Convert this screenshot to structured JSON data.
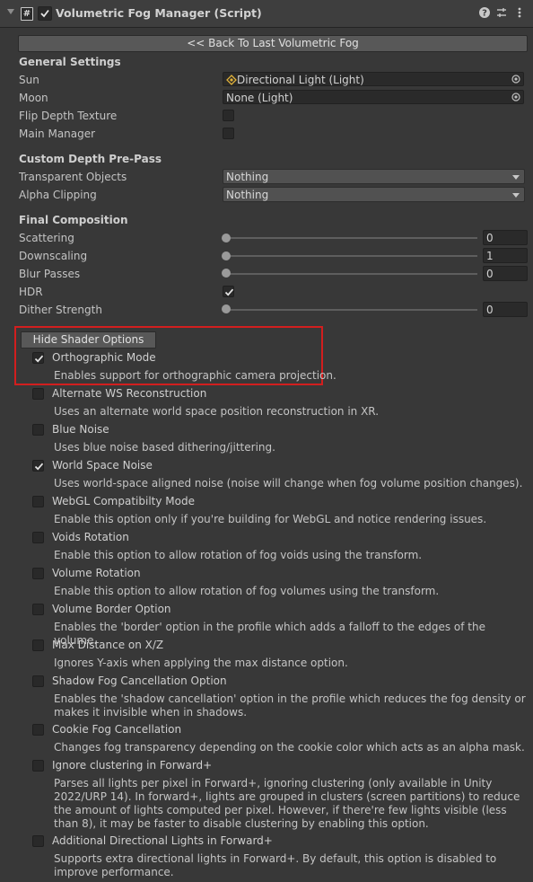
{
  "header": {
    "title": "Volumetric Fog Manager (Script)",
    "enabled": true
  },
  "back_button": "<< Back To Last Volumetric Fog",
  "general": {
    "title": "General Settings",
    "sun_label": "Sun",
    "sun_value": "Directional Light (Light)",
    "moon_label": "Moon",
    "moon_value": "None (Light)",
    "flip_label": "Flip Depth Texture",
    "flip_checked": false,
    "main_label": "Main Manager",
    "main_checked": false
  },
  "custom_depth": {
    "title": "Custom Depth Pre-Pass",
    "transparent_label": "Transparent Objects",
    "transparent_value": "Nothing",
    "alpha_label": "Alpha Clipping",
    "alpha_value": "Nothing"
  },
  "final": {
    "title": "Final Composition",
    "scattering_label": "Scattering",
    "scattering_value": "0",
    "downscaling_label": "Downscaling",
    "downscaling_value": "1",
    "blur_label": "Blur Passes",
    "blur_value": "0",
    "hdr_label": "HDR",
    "hdr_checked": true,
    "dither_label": "Dither Strength",
    "dither_value": "0"
  },
  "shader_options": {
    "toggle_label": "Hide Shader Options",
    "items": [
      {
        "title": "Orthographic Mode",
        "checked": true,
        "desc": "Enables support for orthographic camera projection."
      },
      {
        "title": "Alternate WS Reconstruction",
        "checked": false,
        "desc": "Uses an alternate world space position reconstruction in XR."
      },
      {
        "title": "Blue Noise",
        "checked": false,
        "desc": "Uses blue noise based dithering/jittering."
      },
      {
        "title": "World Space Noise",
        "checked": true,
        "desc": "Uses world-space aligned noise (noise will change when fog volume position changes)."
      },
      {
        "title": "WebGL Compatibilty Mode",
        "checked": false,
        "desc": "Enable this option only if you're building for WebGL and notice rendering issues."
      },
      {
        "title": "Voids Rotation",
        "checked": false,
        "desc": "Enable this option to allow rotation of fog voids using the transform."
      },
      {
        "title": "Volume Rotation",
        "checked": false,
        "desc": "Enable this option to allow rotation of fog volumes using the transform."
      },
      {
        "title": "Volume Border Option",
        "checked": false,
        "desc": "Enables the 'border' option in the profile which adds a falloff to the edges of the volume."
      },
      {
        "title": "Max Distance on X/Z",
        "checked": false,
        "desc": "Ignores Y-axis when applying the max distance option."
      },
      {
        "title": "Shadow Fog Cancellation Option",
        "checked": false,
        "desc": "Enables the 'shadow cancellation' option in the profile which reduces the fog density or makes it invisible when in shadows."
      },
      {
        "title": "Cookie Fog Cancellation",
        "checked": false,
        "desc": "Changes fog transparency depending on the cookie color which acts as an alpha mask."
      },
      {
        "title": "Ignore clustering in Forward+",
        "checked": false,
        "desc": "Parses all lights per pixel in Forward+, ignoring clustering (only available in Unity 2022/URP 14). In forward+, lights are grouped in clusters (screen partitions) to reduce the amount of lights computed per pixel. However, if there're few lights visible (less than 8), it may be faster to disable clustering by enabling this option."
      },
      {
        "title": "Additional Directional Lights in Forward+",
        "checked": false,
        "desc": "Supports extra directional lights in Forward+. By default, this option is disabled to improve performance."
      }
    ]
  },
  "colors": {
    "background": "#383838",
    "header": "#3e3e3e",
    "highlight_box": "#d21e1e"
  },
  "icons": [
    "chevron-down-icon",
    "script-icon",
    "help-icon",
    "preset-icon",
    "more-icon",
    "light-icon",
    "object-picker-icon",
    "checkmark-icon",
    "dropdown-arrow-icon"
  ]
}
